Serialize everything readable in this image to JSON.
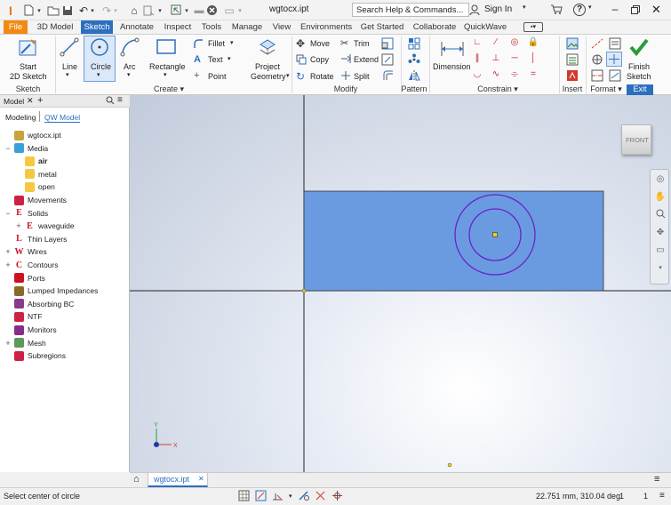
{
  "window": {
    "document_name": "wgtocx.ipt",
    "search_placeholder": "Search Help & Commands...",
    "sign_in": "Sign In",
    "help": "?"
  },
  "tabs": [
    "File",
    "3D Model",
    "Sketch",
    "Annotate",
    "Inspect",
    "Tools",
    "Manage",
    "View",
    "Environments",
    "Get Started",
    "Collaborate",
    "QuickWave"
  ],
  "active_tab": "Sketch",
  "ribbon": {
    "sketch_panel": {
      "title": "Sketch",
      "start_label": "Start",
      "start_label2": "2D Sketch"
    },
    "create_panel": {
      "title": "Create",
      "line": "Line",
      "circle": "Circle",
      "arc": "Arc",
      "rectangle": "Rectangle",
      "fillet": "Fillet",
      "text": "Text",
      "point": "Point",
      "project": "Project",
      "geometry": "Geometry"
    },
    "modify_panel": {
      "title": "Modify",
      "move": "Move",
      "copy": "Copy",
      "rotate": "Rotate",
      "trim": "Trim",
      "extend": "Extend",
      "split": "Split"
    },
    "pattern_panel": {
      "title": "Pattern"
    },
    "constrain_panel": {
      "title": "Constrain",
      "dimension": "Dimension"
    },
    "insert_panel": {
      "title": "Insert"
    },
    "format_panel": {
      "title": "Format"
    },
    "exit_panel": {
      "title": "Exit",
      "finish": "Finish",
      "finish2": "Sketch"
    }
  },
  "browser": {
    "tab_title": "Model",
    "subtabs": [
      "Modeling",
      "QW Model"
    ],
    "active_subtab": "QW Model",
    "tree": [
      {
        "label": "wgtocx.ipt",
        "level": 0,
        "expander": "",
        "icon": "part-icon",
        "color": "#c9a23a"
      },
      {
        "label": "Media",
        "level": 1,
        "expander": "−",
        "icon": "media-icon",
        "color": "#3aa0d8"
      },
      {
        "label": "air",
        "level": 2,
        "expander": "",
        "icon": "media-item-icon",
        "color": "#f5c842",
        "bold": true
      },
      {
        "label": "metal",
        "level": 2,
        "expander": "",
        "icon": "media-item-icon",
        "color": "#f5c842"
      },
      {
        "label": "open",
        "level": 2,
        "expander": "",
        "icon": "media-item-icon",
        "color": "#f5c842"
      },
      {
        "label": "Movements",
        "level": 1,
        "expander": "",
        "icon": "movements-icon",
        "color": "#cc2244"
      },
      {
        "label": "Solids",
        "level": 1,
        "expander": "−",
        "icon": "solids-icon",
        "color": "#cc1122",
        "glyph": "E"
      },
      {
        "label": "waveguide",
        "level": 2,
        "expander": "+",
        "icon": "solid-item-icon",
        "color": "#cc1122",
        "glyph": "E"
      },
      {
        "label": "Thin Layers",
        "level": 1,
        "expander": "",
        "icon": "thin-layers-icon",
        "color": "#cc1122",
        "glyph": "L"
      },
      {
        "label": "Wires",
        "level": 1,
        "expander": "+",
        "icon": "wires-icon",
        "color": "#cc1122",
        "glyph": "W"
      },
      {
        "label": "Contours",
        "level": 1,
        "expander": "+",
        "icon": "contours-icon",
        "color": "#cc1122",
        "glyph": "C"
      },
      {
        "label": "Ports",
        "level": 1,
        "expander": "",
        "icon": "ports-icon",
        "color": "#cc1122"
      },
      {
        "label": "Lumped Impedances",
        "level": 1,
        "expander": "",
        "icon": "lumped-impedances-icon",
        "color": "#8a6a2a"
      },
      {
        "label": "Absorbing BC",
        "level": 1,
        "expander": "",
        "icon": "absorbing-bc-icon",
        "color": "#8a3a8a"
      },
      {
        "label": "NTF",
        "level": 1,
        "expander": "",
        "icon": "ntf-icon",
        "color": "#cc2244"
      },
      {
        "label": "Monitors",
        "level": 1,
        "expander": "",
        "icon": "monitors-icon",
        "color": "#8a2a8a"
      },
      {
        "label": "Mesh",
        "level": 1,
        "expander": "+",
        "icon": "mesh-icon",
        "color": "#5a9a5a"
      },
      {
        "label": "Subregions",
        "level": 1,
        "expander": "",
        "icon": "subregions-icon",
        "color": "#cc2244"
      }
    ]
  },
  "viewcube": {
    "label": "FRONT"
  },
  "doc_tab": {
    "label": "wgtocx.ipt"
  },
  "status": {
    "prompt": "Select center of circle",
    "coords": "22.751 mm, 310.04 deg",
    "count1": "1",
    "count2": "1"
  },
  "colors": {
    "accent": "#2c6fbf",
    "file_tab": "#f08a12",
    "sketch_fill": "#6a9be0",
    "circle": "#6a22c8"
  }
}
